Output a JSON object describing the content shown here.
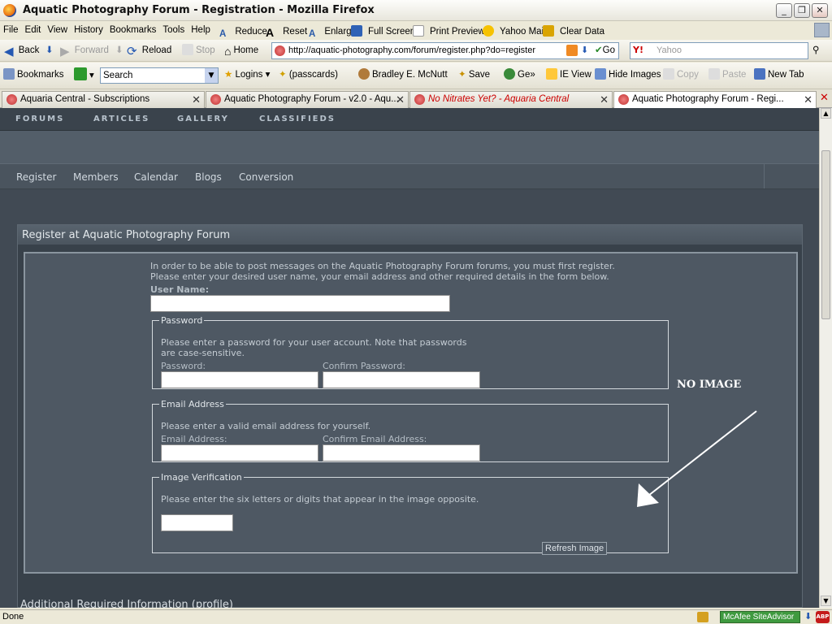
{
  "window": {
    "title": "Aquatic Photography Forum - Registration - Mozilla Firefox"
  },
  "menu": [
    "File",
    "Edit",
    "View",
    "History",
    "Bookmarks",
    "Tools",
    "Help"
  ],
  "toolbar1": {
    "reduce": "Reduce",
    "reset": "Reset",
    "enlarge": "Enlarge",
    "fullscreen": "Full Screen",
    "printpreview": "Print Preview",
    "yahoomail": "Yahoo Mail",
    "cleardata": "Clear Data"
  },
  "nav": {
    "back": "Back",
    "forward": "Forward",
    "reload": "Reload",
    "stop": "Stop",
    "home": "Home",
    "url": "http://aquatic-photography.com/forum/register.php?do=register",
    "go": "Go",
    "search_placeholder": "Yahoo"
  },
  "toolbar3": {
    "bookmarks": "Bookmarks",
    "search_value": "Search",
    "logins": "Logins",
    "passcards": "(passcards)",
    "user": "Bradley E. McNutt",
    "save": "Save",
    "ge": "Ge",
    "ieview": "IE View",
    "hideimages": "Hide Images",
    "copy": "Copy",
    "paste": "Paste",
    "newtab": "New Tab"
  },
  "tabs": [
    {
      "label": "Aquaria Central - Subscriptions"
    },
    {
      "label": "Aquatic Photography Forum - v2.0 - Aqu..."
    },
    {
      "label": "No Nitrates Yet? - Aquaria Central"
    },
    {
      "label": "Aquatic Photography Forum - Regi..."
    }
  ],
  "site_nav": [
    "FORUMS",
    "ARTICLES",
    "GALLERY",
    "CLASSIFIEDS"
  ],
  "site_subnav": [
    "Register",
    "Members",
    "Calendar",
    "Blogs",
    "Conversion"
  ],
  "panel": {
    "title": "Register at Aquatic Photography Forum",
    "intro1": "In order to be able to post messages on the Aquatic Photography Forum forums, you must first register.",
    "intro2": "Please enter your desired user name, your email address and other required details in the form below.",
    "username_label": "User Name:",
    "password": {
      "legend": "Password",
      "desc1": "Please enter a password for your user account. Note that passwords",
      "desc2": "are case-sensitive.",
      "password_label": "Password:",
      "confirm_label": "Confirm Password:"
    },
    "email": {
      "legend": "Email Address",
      "desc": "Please enter a valid email address for yourself.",
      "email_label": "Email Address:",
      "confirm_label": "Confirm Email Address:"
    },
    "verify": {
      "legend": "Image Verification",
      "desc": "Please enter the six letters or digits that appear in the image opposite.",
      "refresh": "Refresh Image"
    },
    "annotation": "NO IMAGE",
    "next_section": "Additional Required Information (profile)"
  },
  "status": {
    "text": "Done",
    "siteadvisor": "McAfee SiteAdvisor",
    "abp": "ABP"
  }
}
